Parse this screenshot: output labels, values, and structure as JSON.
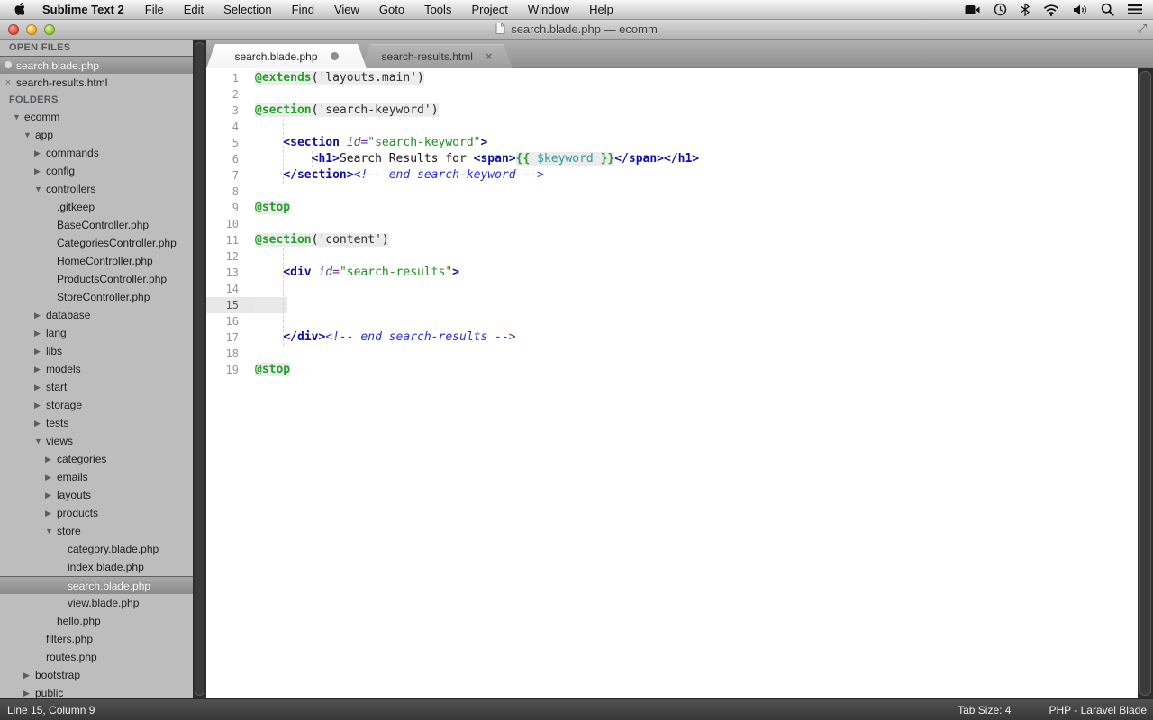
{
  "menu_bar": {
    "app_name": "Sublime Text 2",
    "items": [
      "File",
      "Edit",
      "Selection",
      "Find",
      "View",
      "Goto",
      "Tools",
      "Project",
      "Window",
      "Help"
    ],
    "status_icons": [
      "video-mirroring-icon",
      "time-machine-icon",
      "bluetooth-icon",
      "wifi-icon",
      "volume-icon",
      "spotlight-icon",
      "notification-center-icon"
    ]
  },
  "window": {
    "title": "search.blade.php — ecomm"
  },
  "tabs": [
    {
      "label": "search.blade.php",
      "active": true,
      "modified": true
    },
    {
      "label": "search-results.html",
      "active": false,
      "modified": false
    }
  ],
  "sidebar": {
    "open_files_header": "OPEN FILES",
    "open_files": [
      {
        "name": "search.blade.php",
        "icon": "modified-dot",
        "selected": true
      },
      {
        "name": "search-results.html",
        "icon": "close",
        "selected": false
      }
    ],
    "folders_header": "FOLDERS",
    "tree": [
      {
        "label": "ecomm",
        "level": 0,
        "kind": "folder",
        "state": "open"
      },
      {
        "label": "app",
        "level": 1,
        "kind": "folder",
        "state": "open"
      },
      {
        "label": "commands",
        "level": 2,
        "kind": "folder",
        "state": "closed"
      },
      {
        "label": "config",
        "level": 2,
        "kind": "folder",
        "state": "closed"
      },
      {
        "label": "controllers",
        "level": 2,
        "kind": "folder",
        "state": "open"
      },
      {
        "label": ".gitkeep",
        "level": 3,
        "kind": "file"
      },
      {
        "label": "BaseController.php",
        "level": 3,
        "kind": "file"
      },
      {
        "label": "CategoriesController.php",
        "level": 3,
        "kind": "file"
      },
      {
        "label": "HomeController.php",
        "level": 3,
        "kind": "file"
      },
      {
        "label": "ProductsController.php",
        "level": 3,
        "kind": "file"
      },
      {
        "label": "StoreController.php",
        "level": 3,
        "kind": "file"
      },
      {
        "label": "database",
        "level": 2,
        "kind": "folder",
        "state": "closed"
      },
      {
        "label": "lang",
        "level": 2,
        "kind": "folder",
        "state": "closed"
      },
      {
        "label": "libs",
        "level": 2,
        "kind": "folder",
        "state": "closed"
      },
      {
        "label": "models",
        "level": 2,
        "kind": "folder",
        "state": "closed"
      },
      {
        "label": "start",
        "level": 2,
        "kind": "folder",
        "state": "closed"
      },
      {
        "label": "storage",
        "level": 2,
        "kind": "folder",
        "state": "closed"
      },
      {
        "label": "tests",
        "level": 2,
        "kind": "folder",
        "state": "closed"
      },
      {
        "label": "views",
        "level": 2,
        "kind": "folder",
        "state": "open"
      },
      {
        "label": "categories",
        "level": 3,
        "kind": "folder",
        "state": "closed"
      },
      {
        "label": "emails",
        "level": 3,
        "kind": "folder",
        "state": "closed"
      },
      {
        "label": "layouts",
        "level": 3,
        "kind": "folder",
        "state": "closed"
      },
      {
        "label": "products",
        "level": 3,
        "kind": "folder",
        "state": "closed"
      },
      {
        "label": "store",
        "level": 3,
        "kind": "folder",
        "state": "open"
      },
      {
        "label": "category.blade.php",
        "level": 4,
        "kind": "file"
      },
      {
        "label": "index.blade.php",
        "level": 4,
        "kind": "file"
      },
      {
        "label": "search.blade.php",
        "level": 4,
        "kind": "file",
        "selected": true
      },
      {
        "label": "view.blade.php",
        "level": 4,
        "kind": "file"
      },
      {
        "label": "hello.php",
        "level": 3,
        "kind": "file"
      },
      {
        "label": "filters.php",
        "level": 2,
        "kind": "file"
      },
      {
        "label": "routes.php",
        "level": 2,
        "kind": "file"
      },
      {
        "label": "bootstrap",
        "level": 1,
        "kind": "folder",
        "state": "closed"
      },
      {
        "label": "public",
        "level": 1,
        "kind": "folder",
        "state": "closed"
      }
    ]
  },
  "editor": {
    "current_line": 15,
    "indent_guides": [
      {
        "col": 4,
        "from": 4,
        "to": 7
      },
      {
        "col": 8,
        "from": 6,
        "to": 6
      },
      {
        "col": 4,
        "from": 12,
        "to": 17
      }
    ],
    "lines": [
      {
        "n": 1,
        "tokens": [
          [
            "dir",
            "@extends"
          ],
          [
            "punE",
            "("
          ],
          [
            "strE",
            "'layouts.main'"
          ],
          [
            "punE",
            ")"
          ]
        ]
      },
      {
        "n": 2,
        "tokens": []
      },
      {
        "n": 3,
        "tokens": [
          [
            "dir",
            "@section"
          ],
          [
            "punE",
            "("
          ],
          [
            "strE",
            "'search-keyword'"
          ],
          [
            "punE",
            ")"
          ]
        ]
      },
      {
        "n": 4,
        "tokens": []
      },
      {
        "n": 5,
        "tokens": [
          [
            "txt",
            "    "
          ],
          [
            "tag",
            "<section"
          ],
          [
            "txt",
            " "
          ],
          [
            "attr",
            "id"
          ],
          [
            "eq",
            "="
          ],
          [
            "str",
            "\"search-keyword\""
          ],
          [
            "tag",
            ">"
          ]
        ]
      },
      {
        "n": 6,
        "tokens": [
          [
            "txt",
            "        "
          ],
          [
            "tag",
            "<h1>"
          ],
          [
            "txt",
            "Search Results for "
          ],
          [
            "tag",
            "<span>"
          ],
          [
            "blade",
            "{{"
          ],
          [
            "var",
            " $keyword "
          ],
          [
            "blade",
            "}}"
          ],
          [
            "tag",
            "</span></h1>"
          ]
        ]
      },
      {
        "n": 7,
        "tokens": [
          [
            "txt",
            "    "
          ],
          [
            "tag",
            "</section>"
          ],
          [
            "com",
            "<!-- end search-keyword -->"
          ]
        ]
      },
      {
        "n": 8,
        "tokens": []
      },
      {
        "n": 9,
        "tokens": [
          [
            "dir",
            "@stop"
          ]
        ]
      },
      {
        "n": 10,
        "tokens": []
      },
      {
        "n": 11,
        "tokens": [
          [
            "dir",
            "@section"
          ],
          [
            "punE",
            "("
          ],
          [
            "strE",
            "'content'"
          ],
          [
            "punE",
            ")"
          ]
        ]
      },
      {
        "n": 12,
        "tokens": []
      },
      {
        "n": 13,
        "tokens": [
          [
            "txt",
            "    "
          ],
          [
            "tag",
            "<div"
          ],
          [
            "txt",
            " "
          ],
          [
            "attr",
            "id"
          ],
          [
            "eq",
            "="
          ],
          [
            "str",
            "\"search-results\""
          ],
          [
            "tag",
            ">"
          ]
        ]
      },
      {
        "n": 14,
        "tokens": []
      },
      {
        "n": 15,
        "tokens": []
      },
      {
        "n": 16,
        "tokens": []
      },
      {
        "n": 17,
        "tokens": [
          [
            "txt",
            "    "
          ],
          [
            "tag",
            "</div>"
          ],
          [
            "com",
            "<!-- end search-results -->"
          ]
        ]
      },
      {
        "n": 18,
        "tokens": []
      },
      {
        "n": 19,
        "tokens": [
          [
            "dir",
            "@stop"
          ]
        ]
      }
    ]
  },
  "status_bar": {
    "position": "Line 15, Column 9",
    "tab_size": "Tab Size: 4",
    "syntax": "PHP - Laravel Blade"
  }
}
